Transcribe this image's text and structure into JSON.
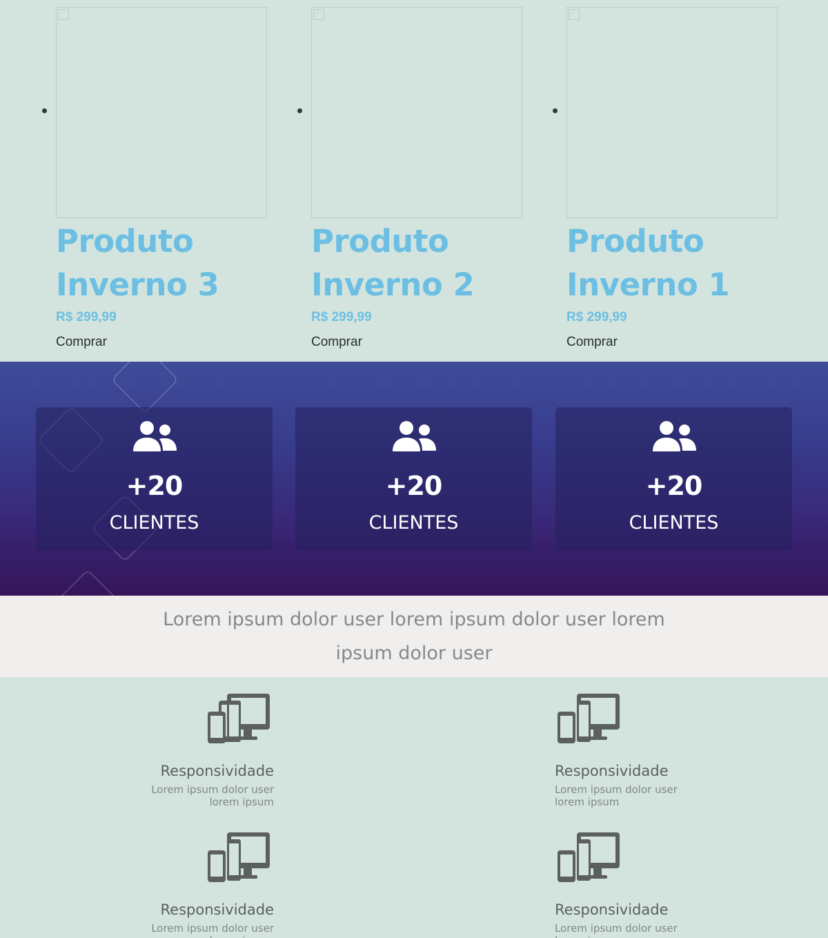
{
  "products": [
    {
      "title": "Produto Inverno 3",
      "price": "R$ 299,99",
      "buy_label": "Comprar"
    },
    {
      "title": "Produto Inverno 2",
      "price": "R$ 299,99",
      "buy_label": "Comprar"
    },
    {
      "title": "Produto Inverno 1",
      "price": "R$ 299,99",
      "buy_label": "Comprar"
    }
  ],
  "stats": [
    {
      "icon": "users-icon",
      "value": "+20",
      "label": "CLIENTES"
    },
    {
      "icon": "users-icon",
      "value": "+20",
      "label": "CLIENTES"
    },
    {
      "icon": "users-icon",
      "value": "+20",
      "label": "CLIENTES"
    }
  ],
  "lorem_band": {
    "text": "Lorem ipsum dolor user lorem ipsum dolor user lorem ipsum dolor user"
  },
  "features": [
    {
      "icon": "devices-icon",
      "title": "Responsividade",
      "text": "Lorem ipsum dolor user lorem ipsum"
    },
    {
      "icon": "devices-icon",
      "title": "Responsividade",
      "text": "Lorem ipsum dolor user lorem ipsum"
    },
    {
      "icon": "devices-icon",
      "title": "Responsividade",
      "text": "Lorem ipsum dolor user lorem ipsum"
    },
    {
      "icon": "devices-icon",
      "title": "Responsividade",
      "text": "Lorem ipsum dolor user lorem ipsum"
    }
  ],
  "colors": {
    "accent": "#6cbfe3",
    "page_background": "#d3e4de",
    "stats_gradient_top": "#3f4c9a",
    "stats_gradient_bottom": "#35145a",
    "lorem_band_background": "#f0efed",
    "feature_icon": "#5b5f60"
  }
}
